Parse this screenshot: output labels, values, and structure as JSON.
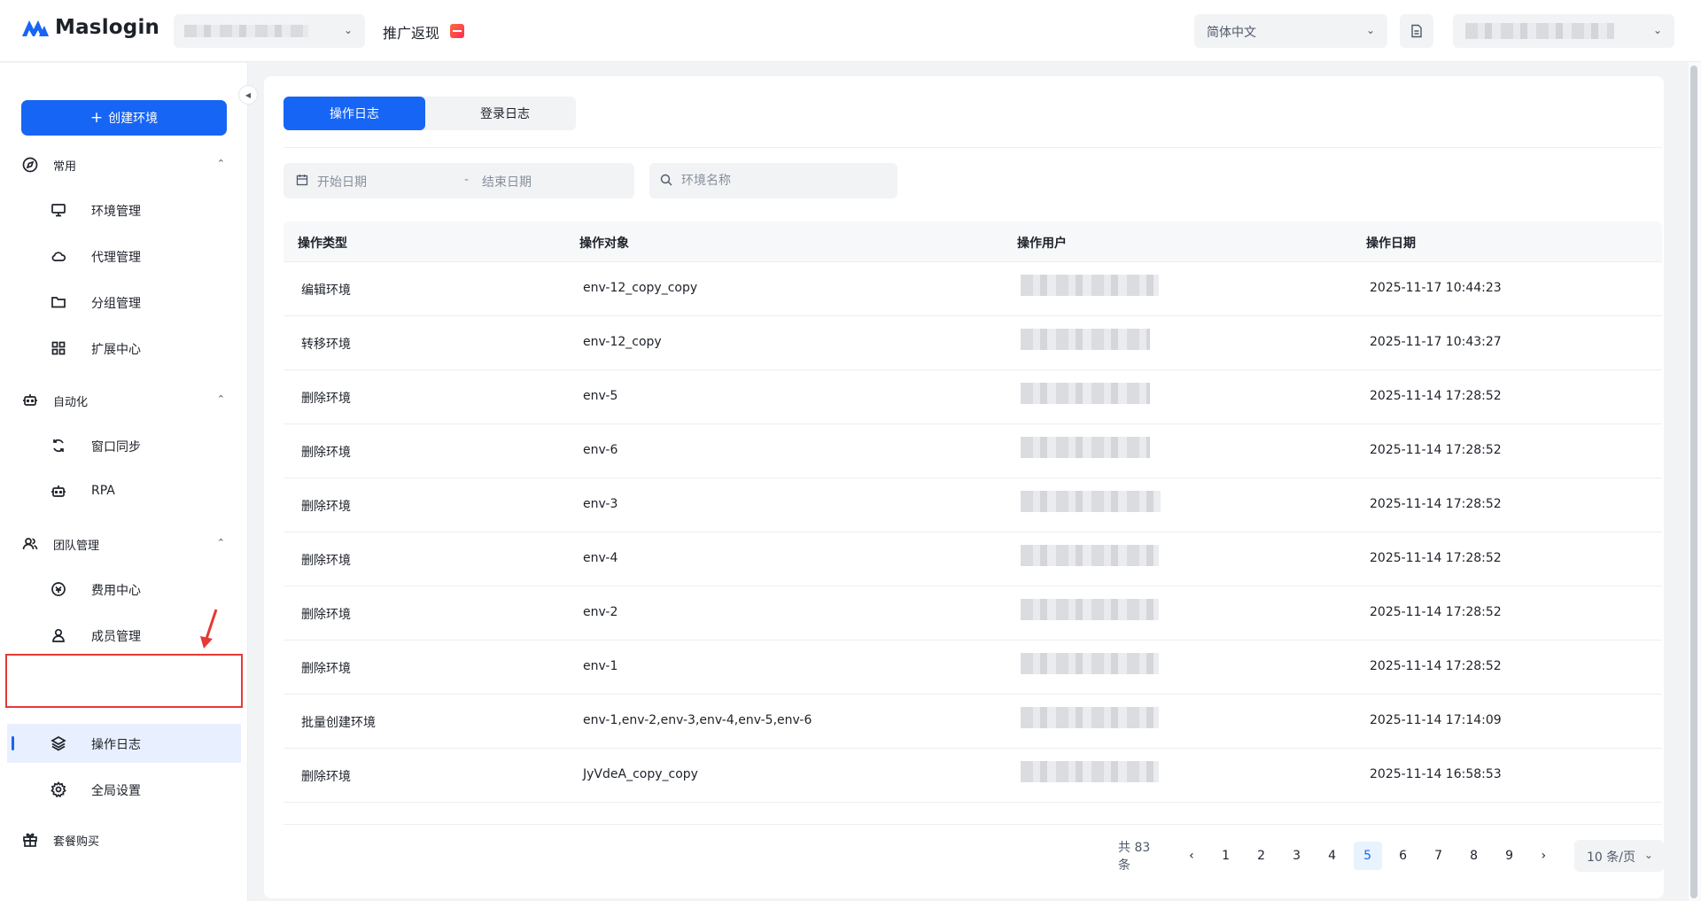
{
  "app": {
    "name": "Maslogin",
    "brand_color": "#1765f5"
  },
  "header": {
    "promo_label": "推广返现",
    "language": "简体中文"
  },
  "sidebar": {
    "create_label": "创建环境",
    "groups": [
      {
        "label": "常用",
        "icon": "compass-icon",
        "items": [
          {
            "label": "环境管理",
            "icon": "monitor-icon"
          },
          {
            "label": "代理管理",
            "icon": "cloud-icon"
          },
          {
            "label": "分组管理",
            "icon": "folder-icon"
          },
          {
            "label": "扩展中心",
            "icon": "grid-icon"
          }
        ]
      },
      {
        "label": "自动化",
        "icon": "robot-icon",
        "items": [
          {
            "label": "窗口同步",
            "icon": "sync-icon"
          },
          {
            "label": "RPA",
            "icon": "robot-icon"
          }
        ]
      },
      {
        "label": "团队管理",
        "icon": "team-icon",
        "items": [
          {
            "label": "费用中心",
            "icon": "coins-icon"
          },
          {
            "label": "成员管理",
            "icon": "user-icon"
          },
          {
            "label": "操作日志",
            "icon": "layers-icon",
            "active": true
          },
          {
            "label": "全局设置",
            "icon": "gear-icon"
          }
        ]
      }
    ],
    "package_label": "套餐购买"
  },
  "main": {
    "tabs": [
      "操作日志",
      "登录日志"
    ],
    "active_tab": 0,
    "filters": {
      "start_placeholder": "开始日期",
      "separator": "-",
      "end_placeholder": "结束日期",
      "search_placeholder": "环境名称"
    },
    "table": {
      "headers": [
        "操作类型",
        "操作对象",
        "操作用户",
        "操作日期"
      ],
      "rows": [
        {
          "type": "编辑环境",
          "target": "env-12_copy_copy",
          "date": "2025-11-17 10:44:23"
        },
        {
          "type": "转移环境",
          "target": "env-12_copy",
          "date": "2025-11-17 10:43:27"
        },
        {
          "type": "删除环境",
          "target": "env-5",
          "date": "2025-11-14 17:28:52"
        },
        {
          "type": "删除环境",
          "target": "env-6",
          "date": "2025-11-14 17:28:52"
        },
        {
          "type": "删除环境",
          "target": "env-3",
          "date": "2025-11-14 17:28:52"
        },
        {
          "type": "删除环境",
          "target": "env-4",
          "date": "2025-11-14 17:28:52"
        },
        {
          "type": "删除环境",
          "target": "env-2",
          "date": "2025-11-14 17:28:52"
        },
        {
          "type": "删除环境",
          "target": "env-1",
          "date": "2025-11-14 17:28:52"
        },
        {
          "type": "批量创建环境",
          "target": "env-1,env-2,env-3,env-4,env-5,env-6",
          "date": "2025-11-14 17:14:09"
        },
        {
          "type": "删除环境",
          "target": "JyVdeA_copy_copy",
          "date": "2025-11-14 16:58:53"
        }
      ]
    },
    "pagination": {
      "total_label": "共 83 条",
      "pages": [
        "1",
        "2",
        "3",
        "4",
        "5",
        "6",
        "7",
        "8",
        "9"
      ],
      "current": "5",
      "page_size": "10 条/页"
    }
  }
}
